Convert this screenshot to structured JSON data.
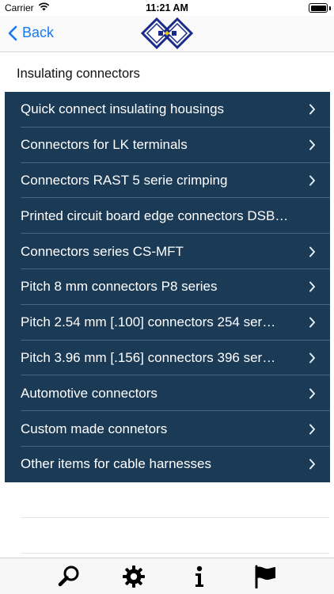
{
  "status_bar": {
    "carrier": "Carrier",
    "time": "11:21 AM",
    "icons": [
      "wifi-icon",
      "battery-icon"
    ]
  },
  "nav_bar": {
    "back_label": "Back",
    "logo": "company-logo"
  },
  "page": {
    "section_title": "Insulating connectors"
  },
  "list": {
    "background_color": "#1b3a55",
    "items": [
      {
        "label": "Quick connect insulating housings",
        "chevron": true
      },
      {
        "label": "Connectors for LK terminals",
        "chevron": true
      },
      {
        "label": "Connectors RAST 5 serie crimping",
        "chevron": true
      },
      {
        "label": "Printed circuit board edge connectors DSB…",
        "chevron": false
      },
      {
        "label": "Connectors series CS-MFT",
        "chevron": true
      },
      {
        "label": "Pitch 8 mm connectors P8 series",
        "chevron": true
      },
      {
        "label": "Pitch 2.54 mm [.100] connectors 254 ser…",
        "chevron": true
      },
      {
        "label": "Pitch 3.96 mm [.156] connectors 396 ser…",
        "chevron": true
      },
      {
        "label": "Automotive connectors",
        "chevron": true
      },
      {
        "label": "Custom made connetors",
        "chevron": true
      },
      {
        "label": "Other items for cable harnesses",
        "chevron": true
      }
    ]
  },
  "tab_bar": {
    "tabs": [
      "search-icon",
      "gear-icon",
      "info-icon",
      "flag-icon"
    ]
  }
}
